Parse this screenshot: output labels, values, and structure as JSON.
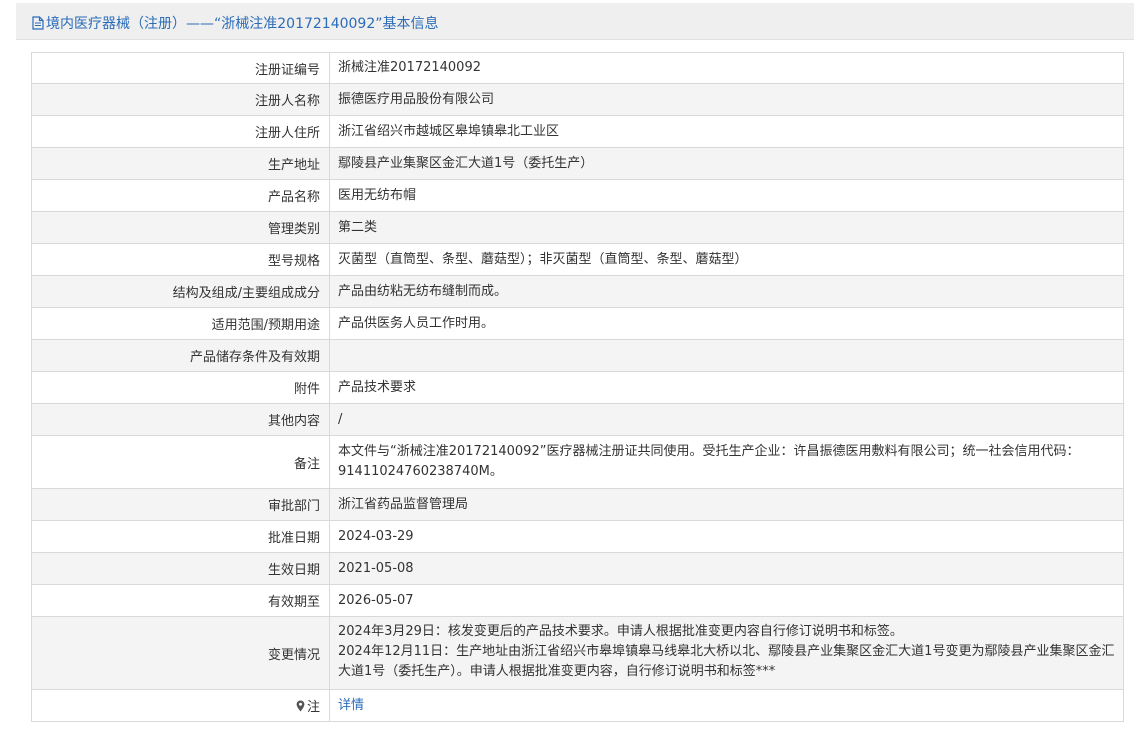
{
  "header": {
    "title": "境内医疗器械（注册）——“浙械注准20172140092”基本信息",
    "icon": "document-icon"
  },
  "rows": [
    {
      "label": "注册证编号",
      "value": "浙械注准20172140092"
    },
    {
      "label": "注册人名称",
      "value": "振德医疗用品股份有限公司"
    },
    {
      "label": "注册人住所",
      "value": "浙江省绍兴市越城区皋埠镇皋北工业区"
    },
    {
      "label": "生产地址",
      "value": "鄢陵县产业集聚区金汇大道1号（委托生产）"
    },
    {
      "label": "产品名称",
      "value": "医用无纺布帽"
    },
    {
      "label": "管理类别",
      "value": "第二类"
    },
    {
      "label": "型号规格",
      "value": "灭菌型（直筒型、条型、蘑菇型）；非灭菌型（直筒型、条型、蘑菇型）"
    },
    {
      "label": "结构及组成/主要组成成分",
      "value": "产品由纺粘无纺布缝制而成。"
    },
    {
      "label": "适用范围/预期用途",
      "value": "产品供医务人员工作时用。"
    },
    {
      "label": "产品储存条件及有效期",
      "value": ""
    },
    {
      "label": "附件",
      "value": "产品技术要求"
    },
    {
      "label": "其他内容",
      "value": "/"
    },
    {
      "label": "备注",
      "value": "本文件与“浙械注准20172140092”医疗器械注册证共同使用。受托生产企业：许昌振德医用敷料有限公司；统一社会信用代码：91411024760238740M。"
    },
    {
      "label": "审批部门",
      "value": "浙江省药品监督管理局"
    },
    {
      "label": "批准日期",
      "value": "2024-03-29"
    },
    {
      "label": "生效日期",
      "value": "2021-05-08"
    },
    {
      "label": "有效期至",
      "value": "2026-05-07"
    },
    {
      "label": "变更情况",
      "lines": [
        "2024年3月29日：核发变更后的产品技术要求。申请人根据批准变更内容自行修订说明书和标签。",
        "2024年12月11日：生产地址由浙江省绍兴市皋埠镇皋马线皋北大桥以北、鄢陵县产业集聚区金汇大道1号变更为鄢陵县产业集聚区金汇大道1号（委托生产）。申请人根据批准变更内容，自行修订说明书和标签***"
      ]
    }
  ],
  "note": {
    "label": "注",
    "icon": "map-pin-icon",
    "link_text": "详情"
  },
  "colors": {
    "header_text": "#2b6cb8",
    "link": "#2b6cb8",
    "row_alt_bg": "#f4f4f4",
    "border": "#d9d9d9"
  }
}
